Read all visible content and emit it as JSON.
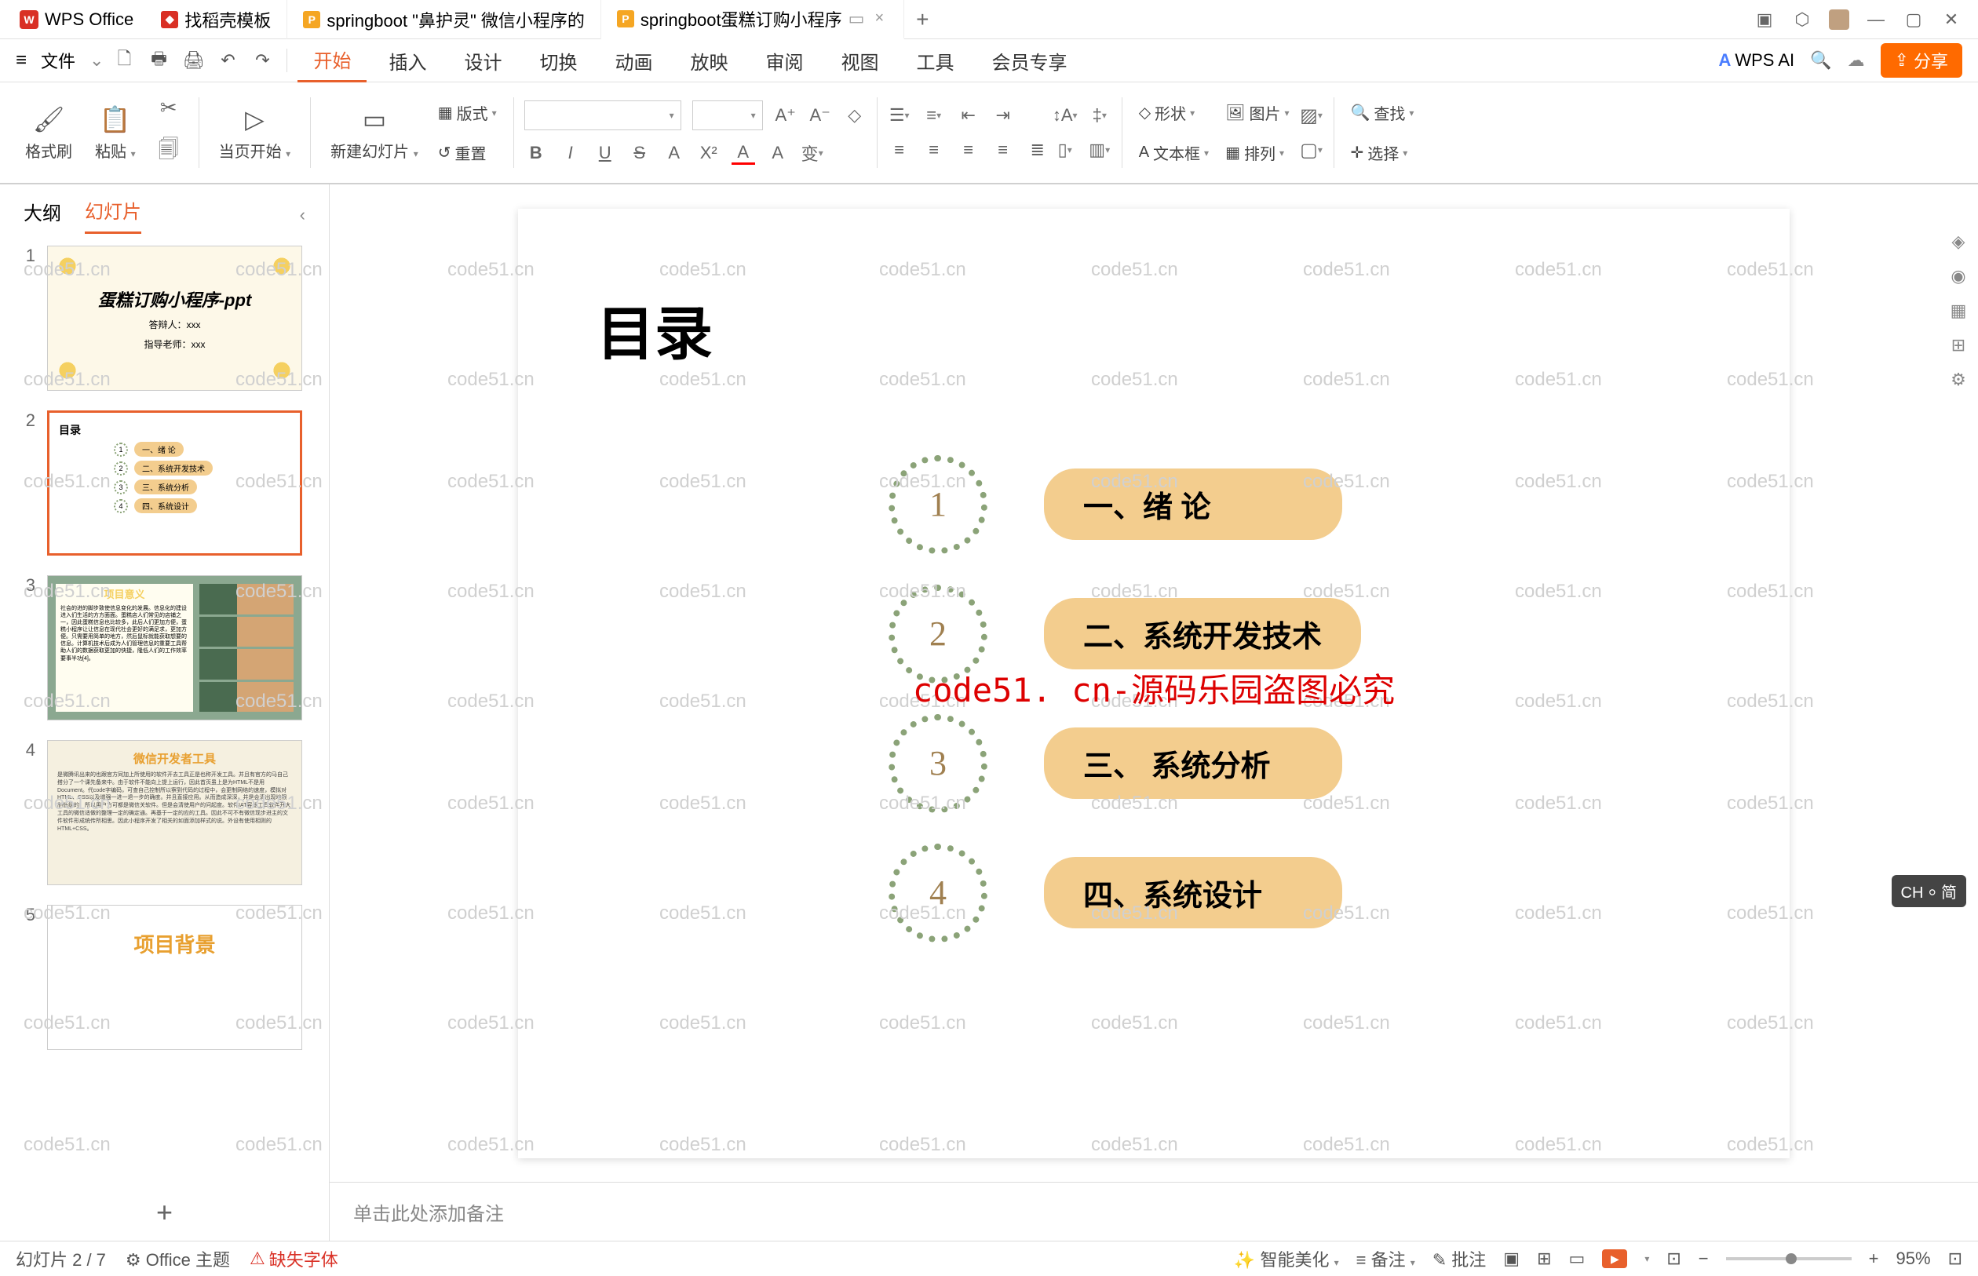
{
  "titlebar": {
    "app_name": "WPS Office",
    "tabs": [
      {
        "label": "找稻壳模板",
        "icon_color": "red"
      },
      {
        "label": "springboot \"鼻护灵\" 微信小程序的",
        "icon_color": "orange"
      },
      {
        "label": "springboot蛋糕订购小程序",
        "icon_color": "orange",
        "active": true
      }
    ],
    "new_tab": "+"
  },
  "menubar": {
    "file": "文件",
    "tabs": [
      "开始",
      "插入",
      "设计",
      "切换",
      "动画",
      "放映",
      "审阅",
      "视图",
      "工具",
      "会员专享"
    ],
    "active_tab": "开始",
    "wps_ai": "WPS AI",
    "share": "分享"
  },
  "ribbon": {
    "format_painter": "格式刷",
    "paste": "粘贴",
    "from_current": "当页开始",
    "new_slide": "新建幻灯片",
    "layout": "版式",
    "reset": "重置",
    "shape": "形状",
    "picture": "图片",
    "textbox": "文本框",
    "arrange": "排列",
    "find": "查找",
    "select": "选择"
  },
  "left_panel": {
    "tab_outline": "大纲",
    "tab_slides": "幻灯片"
  },
  "thumbs": {
    "t1_title": "蛋糕订购小程序-ppt",
    "t1_author": "答辩人：xxx",
    "t1_teacher": "指导老师：xxx",
    "t2_title": "目录",
    "t2_items": [
      "一、绪 论",
      "二、系统开发技术",
      "三、系统分析",
      "四、系统设计"
    ],
    "t3_title": "项目意义",
    "t4_title": "微信开发者工具",
    "t5_title": "项目背景"
  },
  "slide": {
    "title": "目录",
    "items": [
      {
        "num": "1",
        "text": "一、绪  论"
      },
      {
        "num": "2",
        "text": "二、系统开发技术"
      },
      {
        "num": "3",
        "text": "三、 系统分析"
      },
      {
        "num": "4",
        "text": "四、系统设计"
      }
    ],
    "watermark": "code51. cn-源码乐园盗图必究"
  },
  "notes": {
    "placeholder": "单击此处添加备注"
  },
  "statusbar": {
    "slide_counter": "幻灯片 2 / 7",
    "theme": "Office 主题",
    "missing_font": "缺失字体",
    "beautify": "智能美化",
    "notes_btn": "备注",
    "comments": "批注",
    "zoom": "95%"
  },
  "ime": "CH ⸰ 简",
  "wm_text": "code51.cn"
}
